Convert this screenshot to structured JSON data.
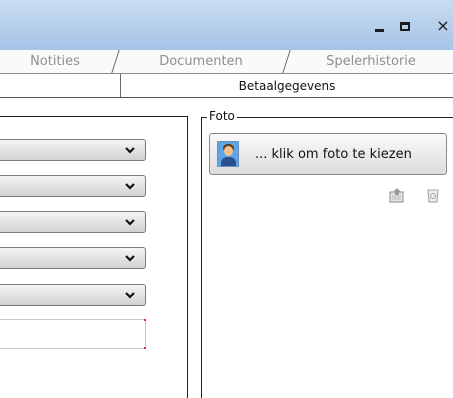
{
  "window": {
    "controls": {
      "minimize": "-",
      "maximize": "□",
      "close": "×"
    }
  },
  "tabs": {
    "row1": [
      "Notities",
      "Documenten",
      "Spelerhistorie"
    ],
    "row2": [
      "Betaalgegevens"
    ]
  },
  "form": {
    "dropdown_count": 5,
    "dropdown_icon": "chevron-down-icon"
  },
  "foto": {
    "legend": "Foto",
    "button_label": "... klik om foto te kiezen",
    "icons": [
      "upload-photo-icon",
      "delete-photo-icon"
    ]
  },
  "colors": {
    "titlebar": "#b4cdeb",
    "tab_inactive_text": "#8f8f8f"
  }
}
